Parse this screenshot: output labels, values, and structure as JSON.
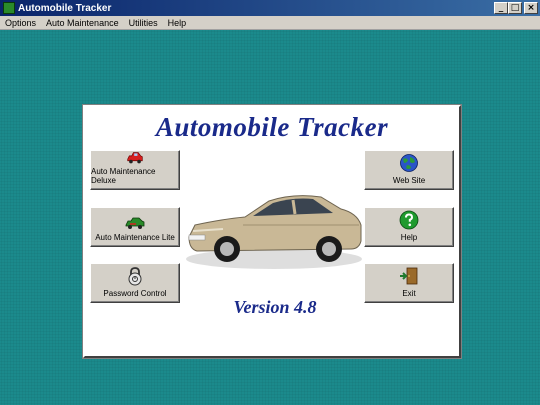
{
  "window": {
    "title": "Automobile Tracker",
    "minimize": "_",
    "maximize": "□",
    "close": "×"
  },
  "menu": {
    "items": [
      "Options",
      "Auto Maintenance",
      "Utilities",
      "Help"
    ]
  },
  "panel": {
    "title": "Automobile Tracker",
    "version": "Version 4.8"
  },
  "buttons": {
    "deluxe": "Auto Maintenance Deluxe",
    "lite": "Auto Maintenance Lite",
    "password": "Password Control",
    "website": "Web Site",
    "help": "Help",
    "exit": "Exit"
  },
  "icons": {
    "deluxe": "red-car-icon",
    "lite": "green-car-icon",
    "password": "lock-icon",
    "website": "globe-icon",
    "help": "question-icon",
    "exit": "exit-door-icon"
  },
  "colors": {
    "desktop": "#1b8a8c",
    "title_text": "#1a2a8a",
    "titlebar": "#0a246a"
  }
}
